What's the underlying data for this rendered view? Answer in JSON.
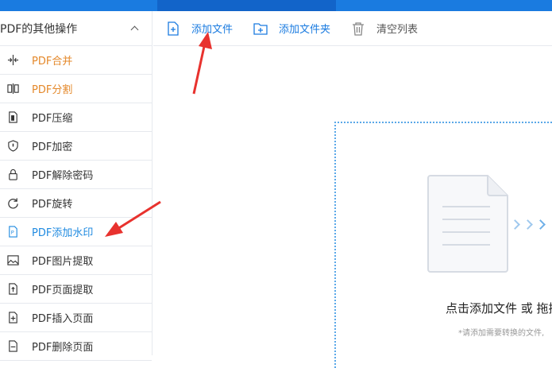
{
  "sidebar": {
    "header_title": "PDF的其他操作",
    "items": [
      {
        "label": "PDF合并",
        "icon": "merge-icon",
        "state": "orange"
      },
      {
        "label": "PDF分割",
        "icon": "split-icon",
        "state": "orange"
      },
      {
        "label": "PDF压缩",
        "icon": "compress-icon",
        "state": "normal"
      },
      {
        "label": "PDF加密",
        "icon": "shield-icon",
        "state": "normal"
      },
      {
        "label": "PDF解除密码",
        "icon": "lock-icon",
        "state": "normal"
      },
      {
        "label": "PDF旋转",
        "icon": "rotate-icon",
        "state": "normal"
      },
      {
        "label": "PDF添加水印",
        "icon": "watermark-icon",
        "state": "active"
      },
      {
        "label": "PDF图片提取",
        "icon": "image-icon",
        "state": "normal"
      },
      {
        "label": "PDF页面提取",
        "icon": "page-extract-icon",
        "state": "normal"
      },
      {
        "label": "PDF插入页面",
        "icon": "page-insert-icon",
        "state": "normal"
      },
      {
        "label": "PDF删除页面",
        "icon": "page-delete-icon",
        "state": "normal"
      }
    ]
  },
  "toolbar": {
    "add_file": "添加文件",
    "add_folder": "添加文件夹",
    "clear_list": "清空列表"
  },
  "dropzone": {
    "main_text": "点击添加文件 或 拖拽",
    "hint_text": "*请添加需要转换的文件,"
  },
  "colors": {
    "accent": "#1a7be0",
    "orange": "#e4882a",
    "annotation_red": "#e8322e"
  }
}
